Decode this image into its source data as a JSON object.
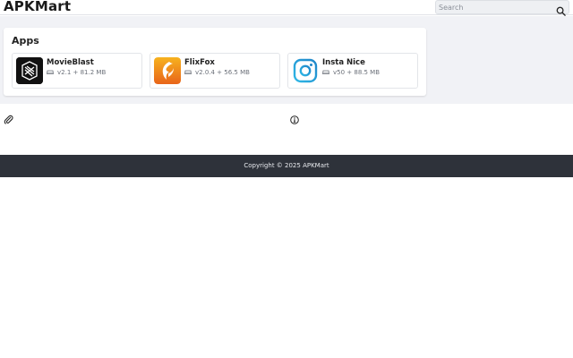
{
  "header": {
    "brand": "APKMart",
    "search": {
      "placeholder": "Search"
    }
  },
  "apps_section": {
    "title": "Apps",
    "items": [
      {
        "name": "MovieBlast",
        "meta": "v2.1 + 81.2 MB",
        "icon": "movieblast-logo-icon"
      },
      {
        "name": "FlixFox",
        "meta": "v2.0.4 + 56.5 MB",
        "icon": "flixfox-logo-icon"
      },
      {
        "name": "Insta Nice",
        "meta": "v50 + 88.5 MB",
        "icon": "instagram-logo-icon"
      }
    ]
  },
  "icons": {
    "search": "search-icon",
    "attachment": "paperclip-icon",
    "info": "info-icon",
    "storage": "hard-drive-icon"
  },
  "colors": {
    "footer_bg": "#2e323a",
    "band_bg": "#f1f2f6",
    "flixfox_orange": "#f08a1c",
    "insta_blue": "#29a3d8"
  },
  "footer": {
    "copyright": "Copyright © 2025 APKMart"
  }
}
